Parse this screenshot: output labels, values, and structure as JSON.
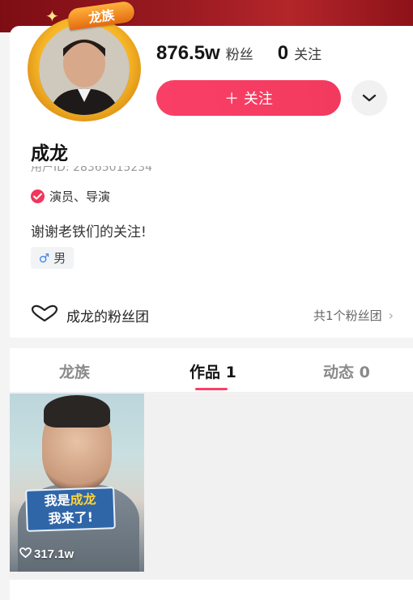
{
  "profile": {
    "badge": "龙族",
    "name": "成龙",
    "user_id": "用户ID: 28365015234",
    "verify_text": "演员、导演",
    "bio": "谢谢老铁们的关注!",
    "gender": "男"
  },
  "stats": {
    "fans_value": "876.5w",
    "fans_label": "粉丝",
    "follow_value": "0",
    "follow_label": "关注"
  },
  "actions": {
    "follow_label": "＋ 关注"
  },
  "fan_club": {
    "title": "成龙的粉丝团",
    "count_text": "共1个粉丝团"
  },
  "tabs": [
    {
      "label": "龙族"
    },
    {
      "label": "作品 1"
    },
    {
      "label": "动态 0"
    }
  ],
  "videos": [
    {
      "sign_line1_a": "我是",
      "sign_line1_b": "成龙",
      "sign_line2": "我来了!",
      "likes": "317.1w"
    }
  ],
  "colors": {
    "accent": "#fa3f66",
    "banner": "#9b1b22",
    "gender_icon": "#3c7ff6"
  }
}
